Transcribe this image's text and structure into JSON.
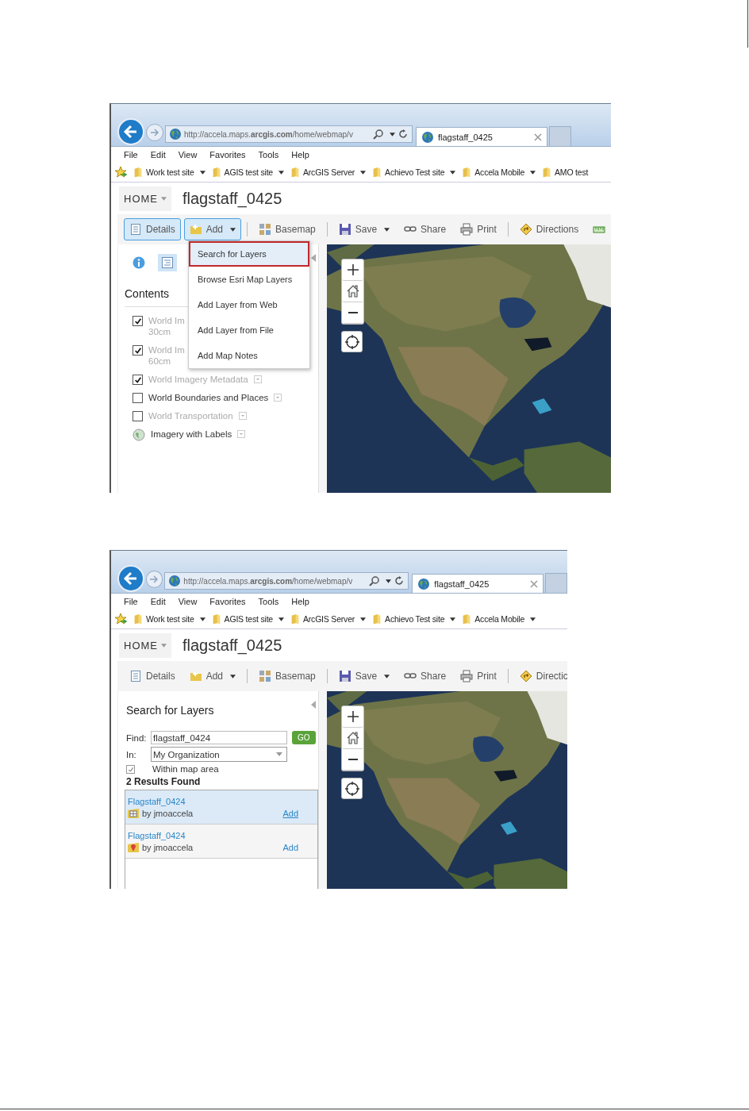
{
  "figures": [
    {
      "address": "http://accela.maps.**arcgis.com**/home/webmap/v",
      "tab": "flagstaff_0425",
      "menu": [
        "File",
        "Edit",
        "View",
        "Favorites",
        "Tools",
        "Help"
      ],
      "favorites": [
        {
          "label": "Work test site",
          "dropdown": true
        },
        {
          "label": "AGIS test site",
          "dropdown": true
        },
        {
          "label": "ArcGIS Server",
          "dropdown": true
        },
        {
          "label": "Achievo Test site",
          "dropdown": true
        },
        {
          "label": "Accela Mobile",
          "dropdown": true
        },
        {
          "label": "AMO test",
          "dropdown": false
        }
      ],
      "home": "HOME",
      "map_title": "flagstaff_0425",
      "toolbar": [
        [
          {
            "label": "Details",
            "dropdown": false,
            "selected": true
          },
          {
            "label": "Add",
            "dropdown": true,
            "selected": true
          }
        ],
        [
          {
            "label": "Basemap",
            "dropdown": false,
            "selected": false
          }
        ],
        [
          {
            "label": "Save",
            "dropdown": true,
            "selected": false
          },
          {
            "label": "Share",
            "dropdown": false,
            "selected": false
          },
          {
            "label": "Print",
            "dropdown": false,
            "selected": false
          }
        ],
        [
          {
            "label": "Directions",
            "dropdown": false,
            "selected": false
          },
          {
            "dropdown": false,
            "selected": false
          }
        ]
      ],
      "add_menu": {
        "items": [
          {
            "label": "Search for Layers",
            "selected": true
          },
          {
            "label": "Browse Esri Map Layers",
            "selected": false
          },
          {
            "label": "Add Layer from Web",
            "selected": false
          },
          {
            "label": "Add Layer from File",
            "selected": false
          },
          {
            "label": "Add Map Notes",
            "selected": false
          }
        ]
      },
      "panel": {
        "kind": "contents",
        "tabs": [
          {
            "selected": false
          },
          {
            "selected": true
          }
        ],
        "title": "Contents",
        "layers": [
          {
            "kind": "layer",
            "name": "World Im",
            "detail": "30cm",
            "checked": true,
            "disabled": true
          },
          {
            "kind": "layer",
            "name": "World Im",
            "detail": "60cm",
            "checked": true,
            "disabled": true
          },
          {
            "kind": "layer",
            "name": "World Imagery Metadata",
            "checked": true,
            "disabled": true
          },
          {
            "kind": "layer",
            "name": "World Boundaries and Places",
            "checked": false,
            "disabled": false
          },
          {
            "kind": "layer",
            "name": "World Transportation",
            "checked": false,
            "disabled": true
          },
          {
            "kind": "basemap",
            "name": "Imagery with Labels",
            "disabled": false
          }
        ]
      }
    },
    {
      "address": "http://accela.maps.**arcgis.com**/home/webmap/v",
      "tab": "flagstaff_0425",
      "menu": [
        "File",
        "Edit",
        "View",
        "Favorites",
        "Tools",
        "Help"
      ],
      "favorites": [
        {
          "label": "Work test site",
          "dropdown": true
        },
        {
          "label": "AGIS test site",
          "dropdown": true
        },
        {
          "label": "ArcGIS Server",
          "dropdown": true
        },
        {
          "label": "Achievo Test site",
          "dropdown": true
        },
        {
          "label": "Accela Mobile",
          "dropdown": true
        }
      ],
      "home": "HOME",
      "map_title": "flagstaff_0425",
      "toolbar": [
        [
          {
            "label": "Details",
            "dropdown": false,
            "selected": false
          },
          {
            "label": "Add",
            "dropdown": true,
            "selected": false
          }
        ],
        [
          {
            "label": "Basemap",
            "dropdown": false,
            "selected": false
          }
        ],
        [
          {
            "label": "Save",
            "dropdown": true,
            "selected": false
          },
          {
            "label": "Share",
            "dropdown": false,
            "selected": false
          },
          {
            "label": "Print",
            "dropdown": false,
            "selected": false
          }
        ],
        [
          {
            "label": "Directic",
            "dropdown": false,
            "selected": false
          }
        ]
      ],
      "panel": {
        "kind": "search",
        "title": "Search for Layers",
        "find_label": "Find:",
        "find_value": "flagstaff_0424",
        "go": "GO",
        "in_label": "In:",
        "in_value": "My Organization",
        "within": {
          "label": "Within map area",
          "checked": true
        },
        "results_heading": "2 Results Found",
        "results": [
          {
            "kind": "map",
            "title": "Flagstaff_0424",
            "owner": "by jmoaccela",
            "add": "Add",
            "selected": true
          },
          {
            "kind": "note",
            "title": "Flagstaff_0424",
            "owner": "by jmoaccela",
            "add": "Add",
            "selected": false
          }
        ]
      }
    }
  ]
}
